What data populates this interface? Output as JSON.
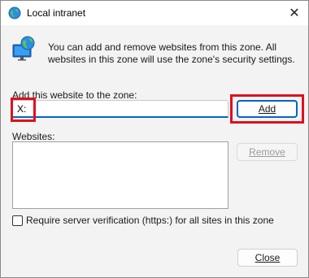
{
  "window": {
    "title": "Local intranet",
    "close_glyph": "✕"
  },
  "info": {
    "text": "You can add and remove websites from this zone. All websites in this zone will use the zone's security settings."
  },
  "add_section": {
    "label": "Add this website to the zone:",
    "input_value": "X:",
    "add_button": "Add"
  },
  "websites": {
    "label": "Websites:",
    "items": [],
    "remove_button": "Remove"
  },
  "options": {
    "require_https_label": "Require server verification (https:) for all sites in this zone",
    "require_https_checked": false
  },
  "footer": {
    "close_button": "Close"
  },
  "icons": {
    "title": "globe-icon",
    "info": "globe-monitor-icon"
  },
  "colors": {
    "accent": "#0067c0",
    "highlight": "#e0101e"
  }
}
